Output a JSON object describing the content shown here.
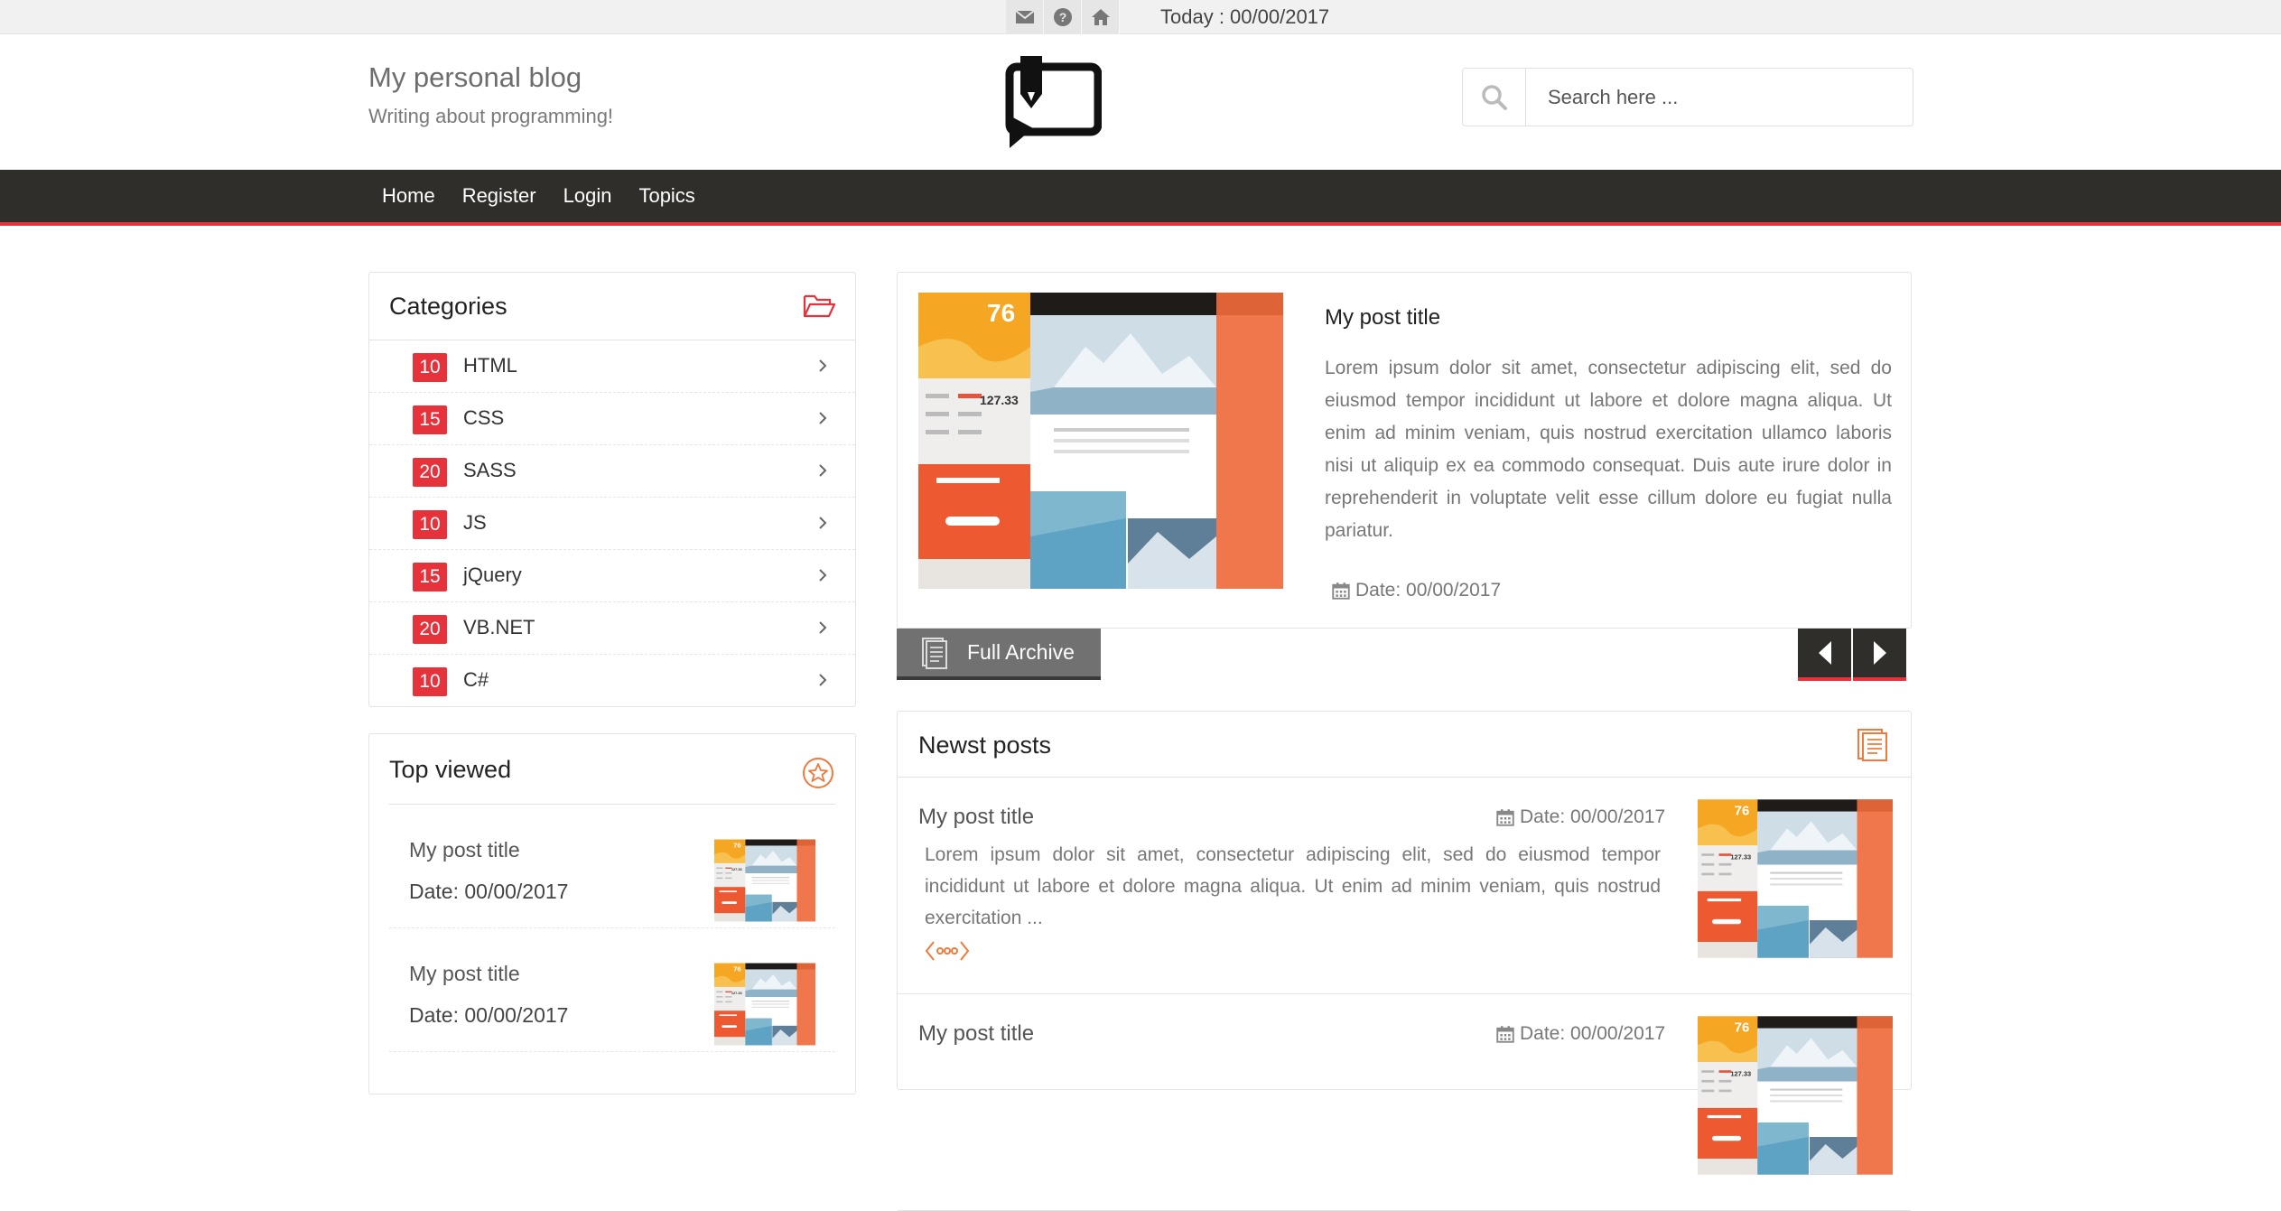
{
  "topbar": {
    "icons": [
      "envelope-icon",
      "question-circle-icon",
      "home-icon"
    ],
    "today": "Today : 00/00/2017"
  },
  "header": {
    "title": "My personal blog",
    "subtitle": "Writing about programming!",
    "search_placeholder": "Search here ..."
  },
  "nav": {
    "items": [
      "Home",
      "Register",
      "Login",
      "Topics"
    ]
  },
  "categories": {
    "title": "Categories",
    "items": [
      {
        "count": "10",
        "name": "HTML"
      },
      {
        "count": "15",
        "name": "CSS"
      },
      {
        "count": "20",
        "name": "SASS"
      },
      {
        "count": "10",
        "name": "JS"
      },
      {
        "count": "15",
        "name": "jQuery"
      },
      {
        "count": "20",
        "name": "VB.NET"
      },
      {
        "count": "10",
        "name": "C#"
      }
    ]
  },
  "top_viewed": {
    "title": "Top viewed",
    "items": [
      {
        "title": "My post title",
        "date": "Date: 00/00/2017"
      },
      {
        "title": "My post title",
        "date": "Date: 00/00/2017"
      }
    ]
  },
  "featured": {
    "title": "My post title",
    "text": "Lorem ipsum dolor sit amet, consectetur adipiscing elit, sed do eiusmod tempor incididunt ut labore et dolore magna aliqua. Ut enim ad minim veniam, quis nostrud exercitation ullamco laboris nisi ut aliquip ex ea commodo consequat. Duis aute irure dolor in reprehenderit in voluptate velit esse cillum dolore eu fugiat nulla pariatur.",
    "date": "Date: 00/00/2017",
    "archive_label": "Full Archive",
    "image_number": "76"
  },
  "newest": {
    "title": "Newst posts",
    "posts": [
      {
        "title": "My post title",
        "date": "Date: 00/00/2017",
        "excerpt": "Lorem ipsum dolor sit amet, consectetur adipiscing elit, sed do eiusmod tempor incididunt ut labore et dolore magna aliqua. Ut enim ad minim veniam, quis nostrud exercitation ..."
      },
      {
        "title": "My post title",
        "date": "Date: 00/00/2017",
        "excerpt": ""
      }
    ]
  },
  "colors": {
    "accent": "#e5323b",
    "nav_bg": "#302e2b",
    "icon_orange": "#f07a3c"
  }
}
